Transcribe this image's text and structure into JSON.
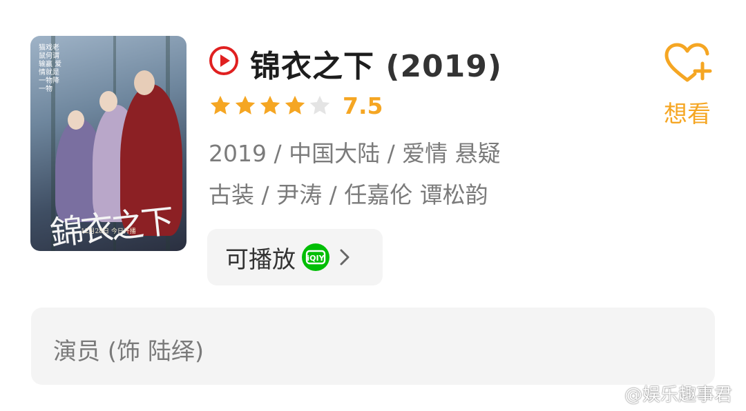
{
  "poster": {
    "vertical_text": "猫戏老鼠何谓输赢 爱情就是一物降一物",
    "calligraphy": "錦衣之下",
    "date_line": "12月28日 今日开播"
  },
  "title": {
    "name": "锦衣之下",
    "year": "(2019)"
  },
  "rating": {
    "stars_filled": 4,
    "stars_total": 5,
    "score": "7.5"
  },
  "meta": {
    "line1": "2019 / 中国大陆 / 爱情 悬疑",
    "line2": "古装 / 尹涛 / 任嘉伦 谭松韵"
  },
  "play": {
    "label": "可播放",
    "platform_icon": "iqiyi-icon"
  },
  "want": {
    "label": "想看",
    "icon": "heart-plus-icon"
  },
  "cast": {
    "label": "演员 (饰 陆绎)"
  },
  "watermark": {
    "text": "@娱乐趣事君",
    "icon": "weibo-icon"
  },
  "colors": {
    "accent": "#f5a623",
    "play_red": "#e02020",
    "iqiyi_green": "#00be06",
    "card_bg": "#f4f4f4"
  }
}
